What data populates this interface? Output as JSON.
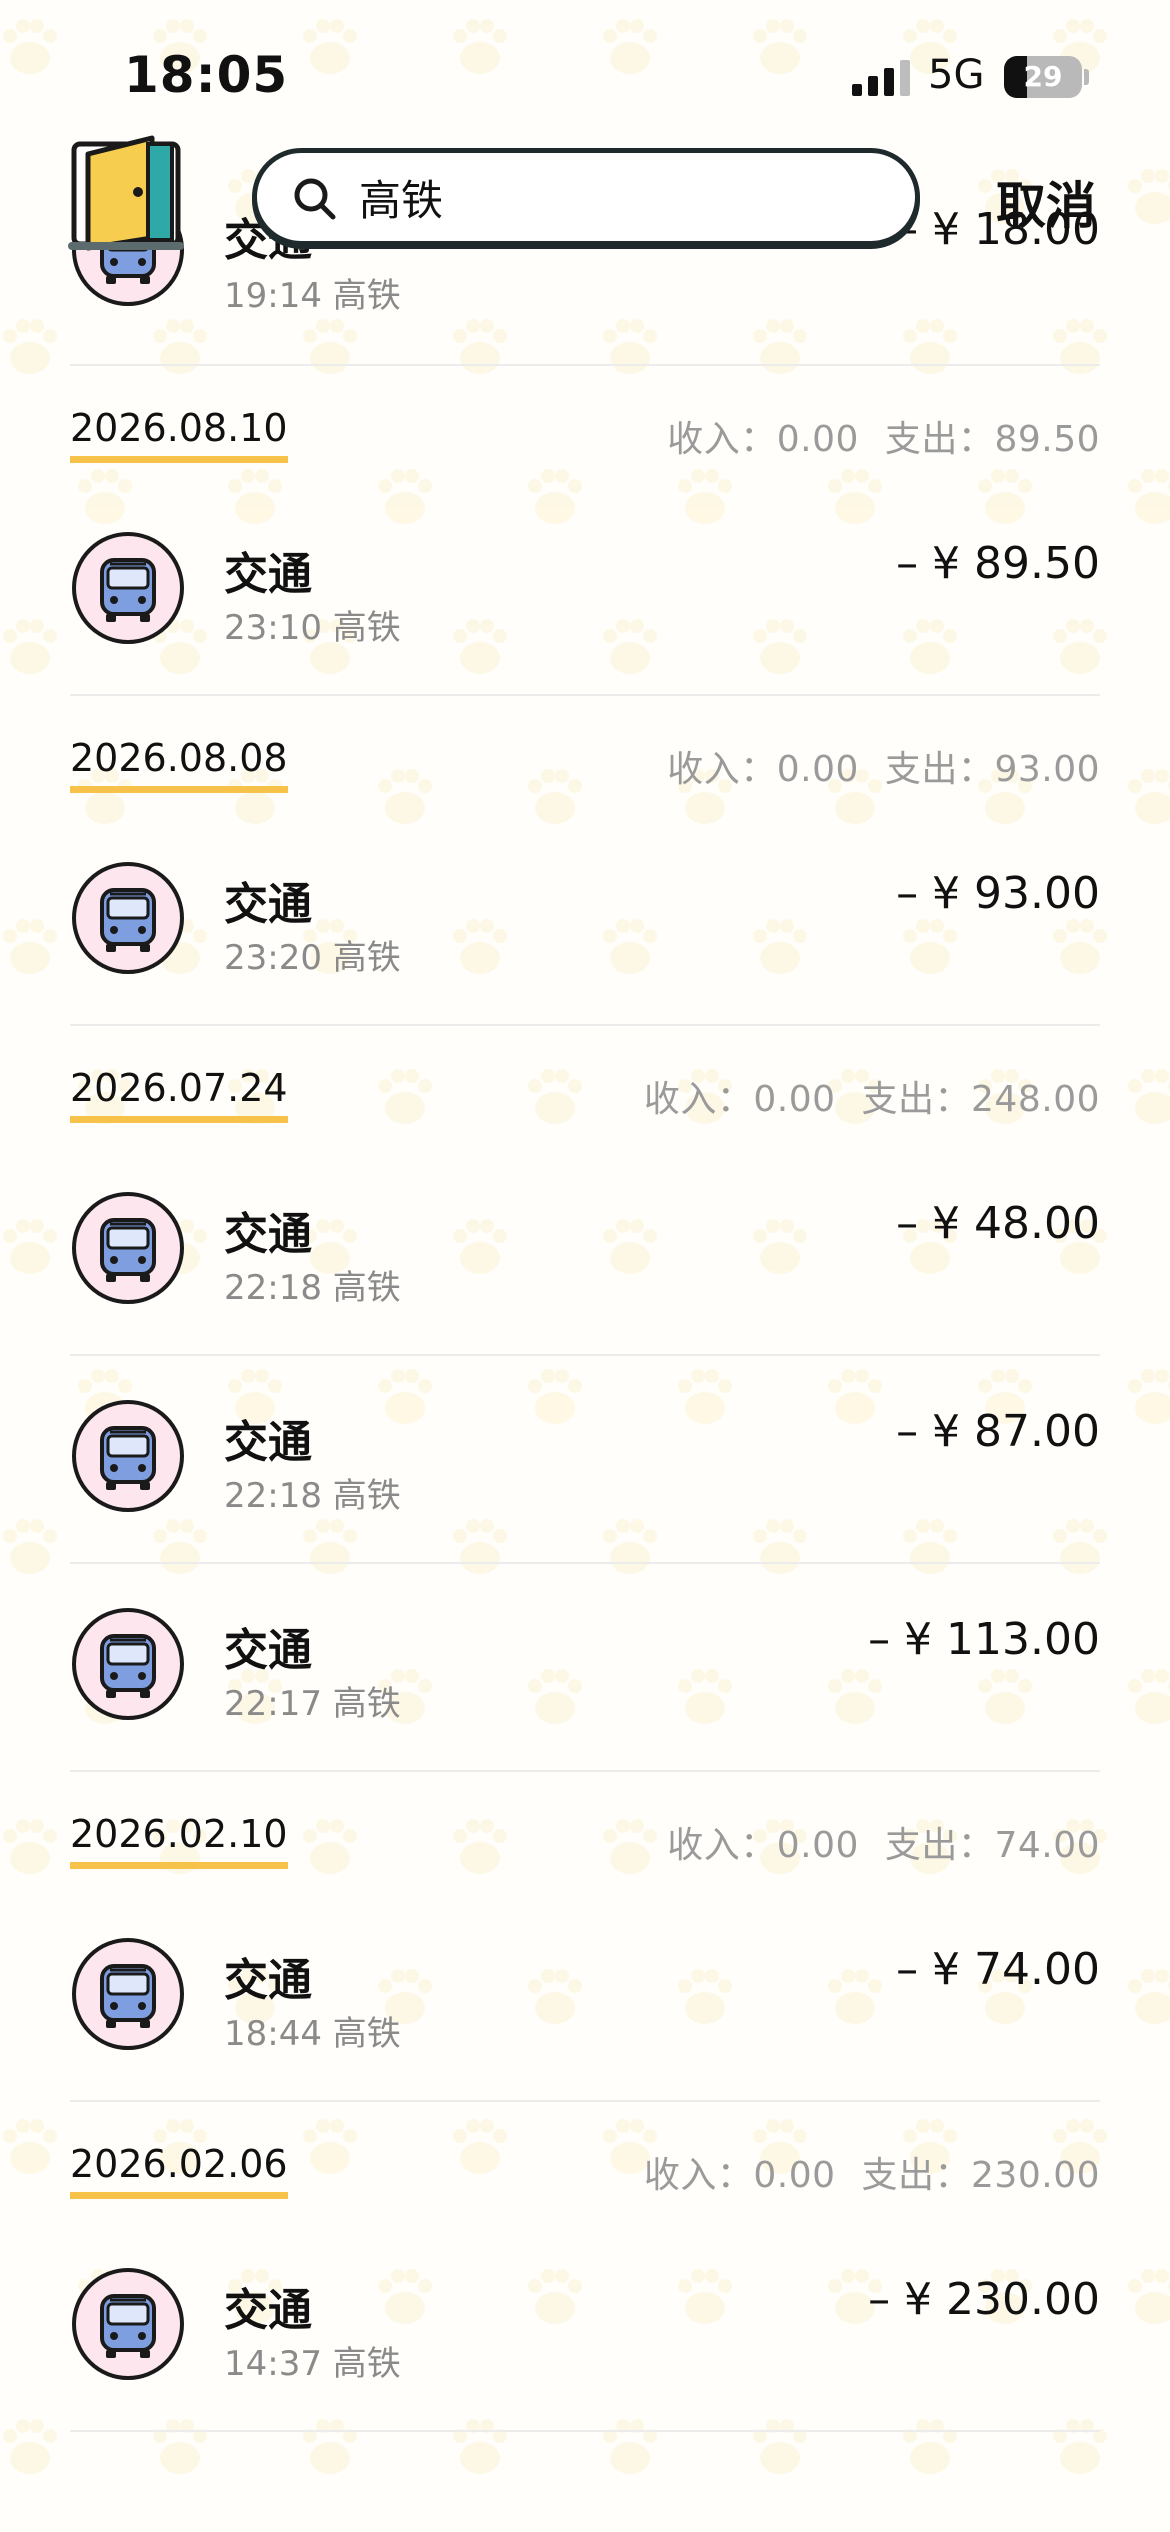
{
  "status_bar": {
    "time": "18:05",
    "network": "5G",
    "battery": "29",
    "battery_level": 0.29
  },
  "header": {
    "search_query": "高铁",
    "cancel_label": "取消"
  },
  "colors": {
    "accent_underline": "#f6c24a",
    "icon_circle": "#fde6ee",
    "bus_fill": "#7f9ee0"
  },
  "partial_record": {
    "title": "交通",
    "time": "19:14",
    "note": "高铁",
    "amount": "– ¥ 18.00",
    "icon": "bus-icon"
  },
  "groups": [
    {
      "date": "2026.08.10",
      "income_label": "收入：",
      "income": "0.00",
      "expense_label": "支出：",
      "expense": "89.50",
      "records": [
        {
          "title": "交通",
          "time": "23:10",
          "note": "高铁",
          "amount": "– ¥ 89.50",
          "icon": "bus-icon"
        }
      ]
    },
    {
      "date": "2026.08.08",
      "income_label": "收入：",
      "income": "0.00",
      "expense_label": "支出：",
      "expense": "93.00",
      "records": [
        {
          "title": "交通",
          "time": "23:20",
          "note": "高铁",
          "amount": "– ¥ 93.00",
          "icon": "bus-icon"
        }
      ]
    },
    {
      "date": "2026.07.24",
      "income_label": "收入：",
      "income": "0.00",
      "expense_label": "支出：",
      "expense": "248.00",
      "records": [
        {
          "title": "交通",
          "time": "22:18",
          "note": "高铁",
          "amount": "– ¥ 48.00",
          "icon": "bus-icon"
        },
        {
          "title": "交通",
          "time": "22:18",
          "note": "高铁",
          "amount": "– ¥ 87.00",
          "icon": "bus-icon"
        },
        {
          "title": "交通",
          "time": "22:17",
          "note": "高铁",
          "amount": "– ¥ 113.00",
          "icon": "bus-icon"
        }
      ]
    },
    {
      "date": "2026.02.10",
      "income_label": "收入：",
      "income": "0.00",
      "expense_label": "支出：",
      "expense": "74.00",
      "records": [
        {
          "title": "交通",
          "time": "18:44",
          "note": "高铁",
          "amount": "– ¥ 74.00",
          "icon": "bus-icon"
        }
      ]
    },
    {
      "date": "2026.02.06",
      "income_label": "收入：",
      "income": "0.00",
      "expense_label": "支出：",
      "expense": "230.00",
      "records": [
        {
          "title": "交通",
          "time": "14:37",
          "note": "高铁",
          "amount": "– ¥ 230.00",
          "icon": "bus-icon"
        }
      ]
    }
  ]
}
